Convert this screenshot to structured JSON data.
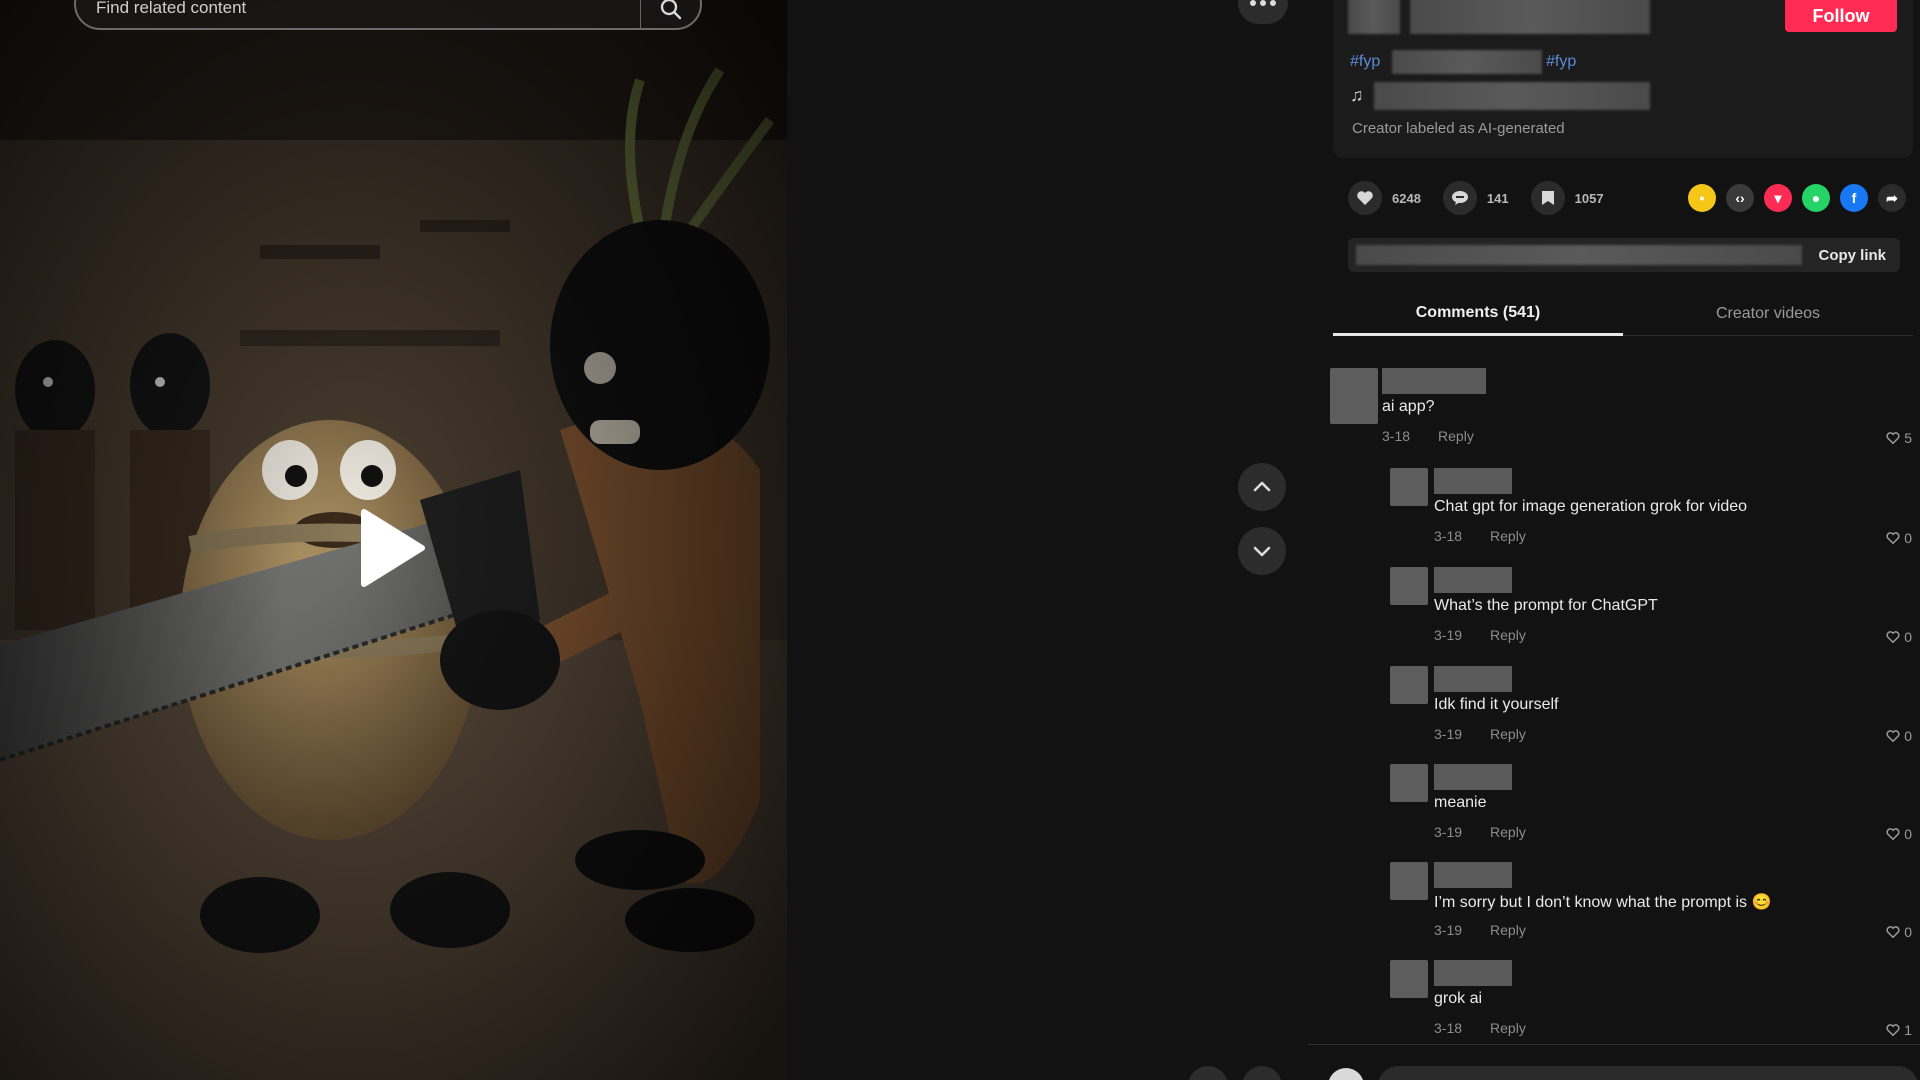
{
  "search": {
    "placeholder": "Find related content"
  },
  "video": {
    "state": "paused"
  },
  "info": {
    "follow_label": "Follow",
    "hashtag_1": "#fyp",
    "hashtag_2": "#fyp",
    "music_icon": "♫",
    "ai_label": "Creator labeled as AI-generated"
  },
  "actions": {
    "likes": "6248",
    "comments": "141",
    "saves": "1057"
  },
  "share": {
    "icons": [
      "embed-icon",
      "code-icon",
      "tiktok-friends-icon",
      "whatsapp-icon",
      "facebook-icon",
      "share-arrow-icon"
    ],
    "colors": [
      "#f5c518",
      "#3a3a3a",
      "#fe2c55",
      "#25d366",
      "#1877f2",
      "#2b2b2b"
    ],
    "copy_label": "Copy link"
  },
  "tabs": {
    "comments": "Comments (541)",
    "creator": "Creator videos"
  },
  "comments": [
    {
      "text": "ai app?",
      "date": "3-18",
      "reply": "Reply",
      "likes": "5"
    },
    {
      "text": "Chat gpt for image generation grok for video",
      "date": "3-18",
      "reply": "Reply",
      "likes": "0"
    },
    {
      "text": "What’s the prompt for ChatGPT",
      "date": "3-19",
      "reply": "Reply",
      "likes": "0"
    },
    {
      "text": "Idk find it yourself",
      "date": "3-19",
      "reply": "Reply",
      "likes": "0"
    },
    {
      "text": "meanie",
      "date": "3-19",
      "reply": "Reply",
      "likes": "0"
    },
    {
      "text": "I’m sorry but I don’t know what the prompt is 😊",
      "date": "3-19",
      "reply": "Reply",
      "likes": "0"
    },
    {
      "text": "grok ai",
      "date": "3-18",
      "reply": "Reply",
      "likes": "1"
    }
  ]
}
